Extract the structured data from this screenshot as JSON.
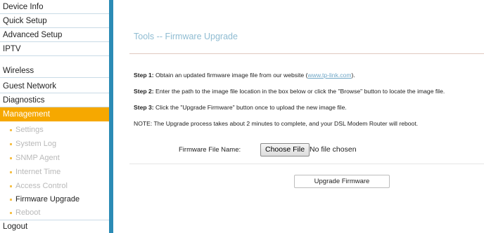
{
  "sidebar": {
    "items": [
      {
        "label": "Device Info"
      },
      {
        "label": "Quick Setup"
      },
      {
        "label": "Advanced Setup"
      },
      {
        "label": "IPTV"
      },
      {
        "label": "Wireless"
      },
      {
        "label": "Guest Network"
      },
      {
        "label": "Diagnostics"
      },
      {
        "label": "Management"
      }
    ],
    "active_item": "Management",
    "subitems": [
      {
        "label": "Settings"
      },
      {
        "label": "System Log"
      },
      {
        "label": "SNMP Agent"
      },
      {
        "label": "Internet Time"
      },
      {
        "label": "Access Control"
      },
      {
        "label": "Firmware Upgrade"
      },
      {
        "label": "Reboot"
      }
    ],
    "current_subitem": "Firmware Upgrade",
    "logout_label": "Logout"
  },
  "main": {
    "title": "Tools -- Firmware Upgrade",
    "steps": [
      {
        "prefix": "Step 1:",
        "text": " Obtain an updated firmware image file from our website (",
        "link": "www.tp-link.com",
        "suffix": ")."
      },
      {
        "prefix": "Step 2:",
        "text": " Enter the path to the image file location in the box below or click the \"Browse\" button to locate the image file."
      },
      {
        "prefix": "Step 3:",
        "text": " Click the \"Upgrade Firmware\" button once to upload the new image file."
      },
      {
        "prefix": "",
        "text": "NOTE: The Upgrade process takes about 2 minutes to complete, and your DSL Modem Router will reboot."
      }
    ],
    "file_field": {
      "label": "Firmware File Name:",
      "button_label": "Choose File",
      "status": "No file chosen"
    },
    "upgrade_button_label": "Upgrade Firmware"
  },
  "colors": {
    "accent_bar": "#2b8bb5",
    "active_bg": "#f6a800",
    "title": "#8fbcd2"
  }
}
